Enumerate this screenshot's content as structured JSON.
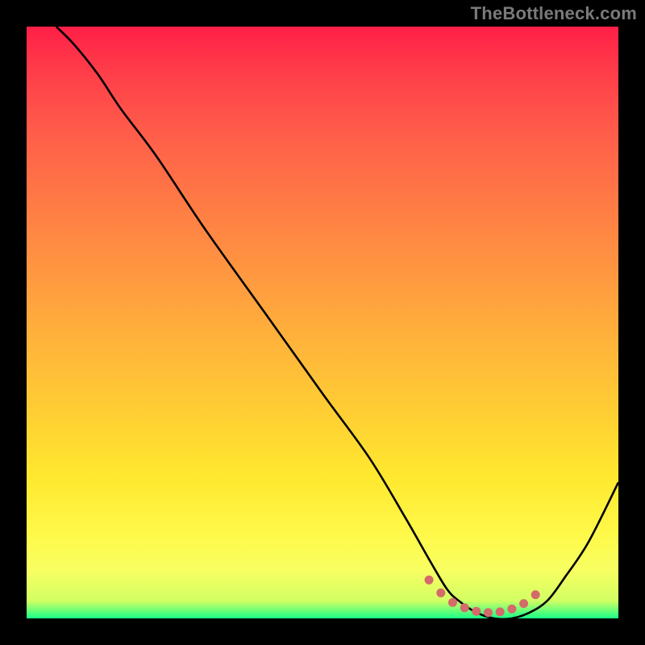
{
  "watermark": "TheBottleneck.com",
  "colors": {
    "background": "#000000",
    "curve_stroke": "#000000",
    "marker": "#d46a6a",
    "gradient_top": "#ff1f47",
    "gradient_mid": "#ffd033",
    "gradient_bottom": "#18ff88"
  },
  "chart_data": {
    "type": "line",
    "title": "",
    "xlabel": "",
    "ylabel": "",
    "xlim": [
      0,
      100
    ],
    "ylim": [
      0,
      100
    ],
    "grid": false,
    "legend": false,
    "series": [
      {
        "name": "curve",
        "x": [
          5,
          8,
          12,
          16,
          22,
          30,
          40,
          50,
          58,
          64,
          68,
          71,
          73,
          76,
          79,
          82,
          85,
          88,
          91,
          95,
          100
        ],
        "y": [
          100,
          97,
          92,
          86,
          78,
          66,
          52,
          38,
          27,
          17,
          10,
          5,
          3,
          1,
          0,
          0,
          1,
          3,
          7,
          13,
          23
        ]
      }
    ],
    "markers": {
      "name": "bottom-markers",
      "x": [
        68,
        70,
        72,
        74,
        76,
        78,
        80,
        82,
        84,
        86
      ],
      "y": [
        6.5,
        4.3,
        2.7,
        1.8,
        1.2,
        1.0,
        1.1,
        1.6,
        2.5,
        4.0
      ]
    }
  }
}
